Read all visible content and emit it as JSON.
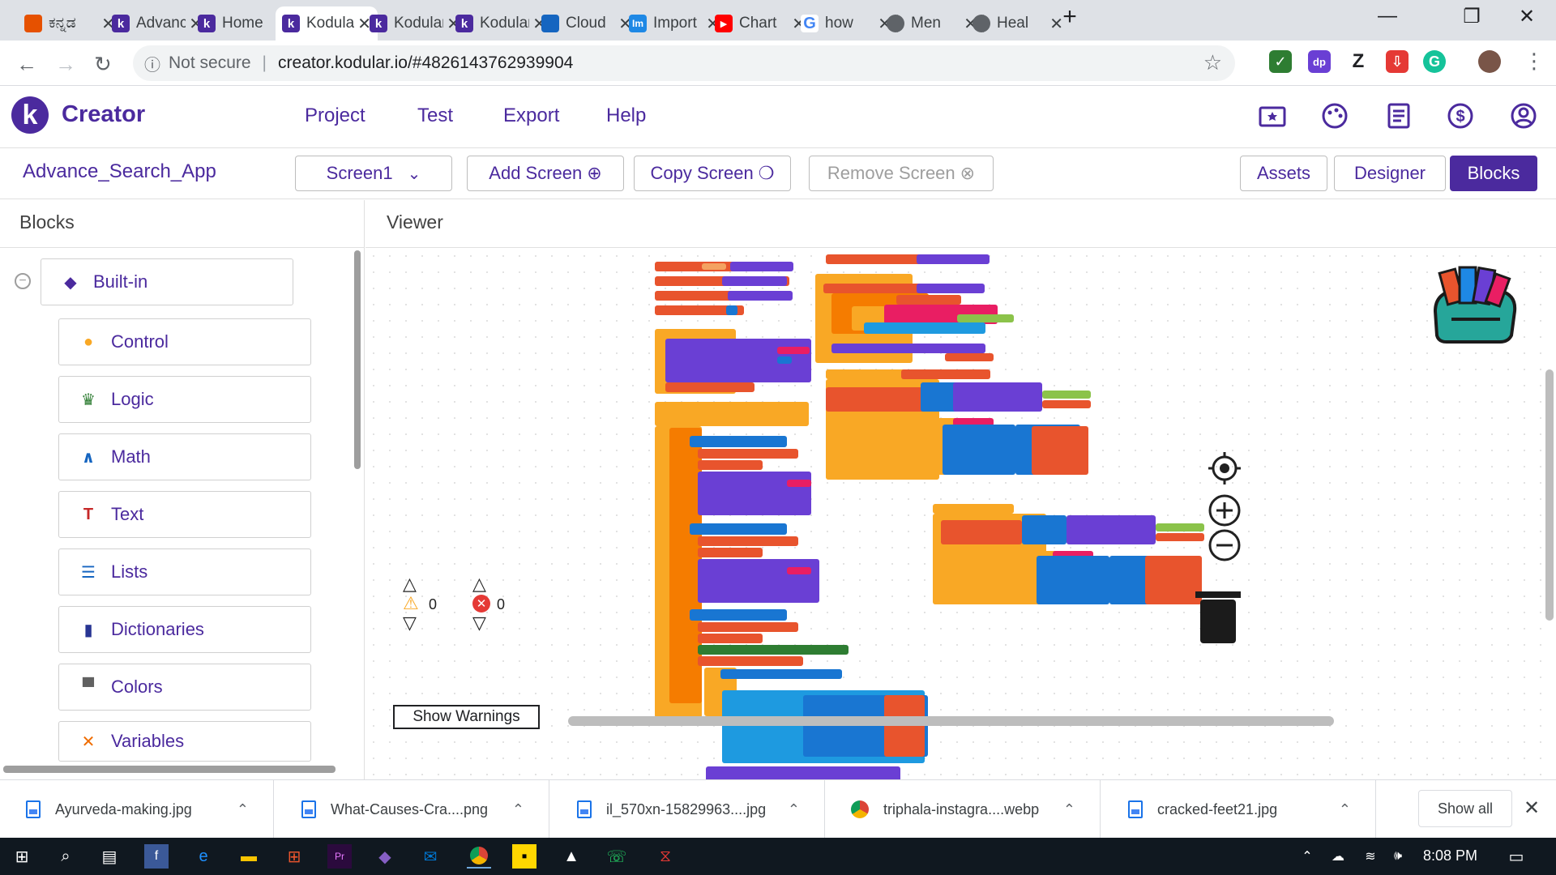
{
  "browser": {
    "tabs": [
      {
        "title": "ಕನ್ನಡ",
        "favicon_color": "#e65100",
        "active": false
      },
      {
        "title": "Advance",
        "favicon_color": "#4b2a9e",
        "active": false
      },
      {
        "title": "Home",
        "favicon_color": "#4b2a9e",
        "active": false
      },
      {
        "title": "Kodular",
        "favicon_color": "#4b2a9e",
        "active": true
      },
      {
        "title": "Kodular",
        "favicon_color": "#4b2a9e",
        "active": false
      },
      {
        "title": "Kodular",
        "favicon_color": "#4b2a9e",
        "active": false
      },
      {
        "title": "Cloud",
        "favicon_color": "#1565c0",
        "active": false
      },
      {
        "title": "Import",
        "favicon_color": "#1e88e5",
        "active": false
      },
      {
        "title": "Chart",
        "favicon_color": "#ff0000",
        "active": false
      },
      {
        "title": "how",
        "favicon_color": "#4285f4",
        "active": false
      },
      {
        "title": "Men",
        "favicon_color": "#5f6368",
        "active": false
      },
      {
        "title": "Heal",
        "favicon_color": "#5f6368",
        "active": false
      }
    ],
    "new_tab": "+",
    "security_label": "Not secure",
    "url": "creator.kodular.io/#4826143762939904"
  },
  "header": {
    "brand": "Creator",
    "logo_letter": "k",
    "menu": [
      "Project",
      "Test",
      "Export",
      "Help"
    ],
    "accent": "#4b2a9e"
  },
  "toolbar": {
    "project_name": "Advance_Search_App",
    "screen_select": "Screen1",
    "add_screen": "Add Screen",
    "copy_screen": "Copy Screen",
    "remove_screen": "Remove Screen",
    "assets": "Assets",
    "designer": "Designer",
    "blocks": "Blocks"
  },
  "palette": {
    "title": "Blocks",
    "root": "Built-in",
    "items": [
      {
        "label": "Control",
        "icon": "control-icon",
        "color": "#f9a825"
      },
      {
        "label": "Logic",
        "icon": "logic-icon",
        "color": "#2e7d32"
      },
      {
        "label": "Math",
        "icon": "math-icon",
        "color": "#1565c0"
      },
      {
        "label": "Text",
        "icon": "text-icon",
        "color": "#c62828"
      },
      {
        "label": "Lists",
        "icon": "lists-icon",
        "color": "#1565c0"
      },
      {
        "label": "Dictionaries",
        "icon": "dictionaries-icon",
        "color": "#283593"
      },
      {
        "label": "Colors",
        "icon": "colors-icon",
        "color": "#616161"
      },
      {
        "label": "Variables",
        "icon": "variables-icon",
        "color": "#ef6c00"
      }
    ]
  },
  "viewer": {
    "title": "Viewer",
    "warnings_count": "0",
    "errors_count": "0",
    "show_warnings": "Show Warnings"
  },
  "downloads": {
    "items": [
      "Ayurveda-making.jpg",
      "What-Causes-Cra....png",
      "il_570xn-15829963....jpg",
      "triphala-instagra....webp",
      "cracked-feet21.jpg"
    ],
    "show_all": "Show all"
  },
  "taskbar": {
    "time": "8:08 PM"
  }
}
